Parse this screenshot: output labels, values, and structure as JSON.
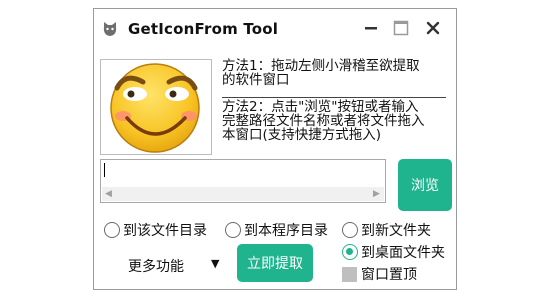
{
  "window": {
    "title": "GetIconFrom Tool"
  },
  "titlebar": {
    "min_icon": "minimize-icon",
    "max_icon": "maximize-icon",
    "close_icon": "close-icon"
  },
  "methods": {
    "method1_line1": "方法1：拖动左侧小滑稽至欲提取",
    "method1_line2": "的软件窗口",
    "method2_line1": "方法2：点击\"浏览\"按钮或者输入",
    "method2_line2": "完整路径文件名称或者将文件拖入",
    "method2_line3": "本窗口(支持快捷方式拖入)"
  },
  "path_input": {
    "value": ""
  },
  "browse_label": "浏览",
  "options": {
    "to_file_dir": "到该文件目录",
    "to_program_dir": "到本程序目录",
    "to_new_folder": "到新文件夹",
    "to_desktop_folder": "到桌面文件夹",
    "always_on_top": "窗口置顶",
    "selected": "到桌面文件夹"
  },
  "more_label": "更多功能",
  "extract_label": "立即提取",
  "colors": {
    "accent": "#1fb48e"
  }
}
